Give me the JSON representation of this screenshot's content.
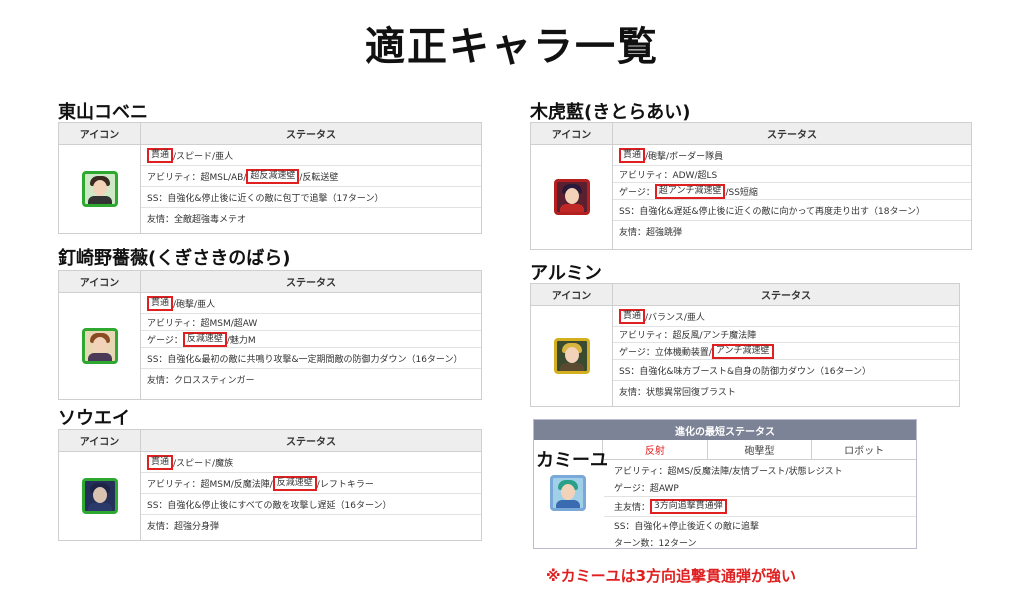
{
  "page_title": "適正キャラ一覧",
  "header": {
    "icon": "アイコン",
    "status": "ステータス"
  },
  "cards": [
    {
      "name": "東山コベニ",
      "rows": [
        {
          "hl": "貫通",
          "text": "/スピード/亜人"
        },
        {
          "pre": "アビリティ：超MSL/AB/",
          "hl": "超反減速壁",
          "text": "/反転送壁"
        },
        {
          "text": "SS：自強化&停止後に近くの敵に包丁で追撃（17ターン）"
        },
        {
          "text": "友情：全敵超強毒メテオ"
        }
      ]
    },
    {
      "name": "釘崎野薔薇(くぎさきのばら)",
      "rows": [
        {
          "hl": "貫通",
          "text": "/砲撃/亜人"
        },
        {
          "text": "アビリティ：超MSM/超AW"
        },
        {
          "pre": "ゲージ：",
          "hl": "反減速壁",
          "text": "/魅力M"
        },
        {
          "text": "SS：自強化&最初の敵に共鳴り攻撃&一定期間敵の防御力ダウン（16ターン）"
        },
        {
          "text": "友情：クロススティンガー"
        }
      ]
    },
    {
      "name": "ソウエイ",
      "rows": [
        {
          "hl": "貫通",
          "text": "/スピード/魔族"
        },
        {
          "pre": "アビリティ：超MSM/反魔法陣/",
          "hl": "反減速壁",
          "text": "/レフトキラー"
        },
        {
          "text": "SS：自強化&停止後にすべての敵を攻撃し遅延（16ターン）"
        },
        {
          "text": "友情：超強分身弾"
        }
      ]
    },
    {
      "name": "木虎藍(きとらあい)",
      "rows": [
        {
          "hl": "貫通",
          "text": "/砲撃/ボーダー隊員"
        },
        {
          "text": "アビリティ：ADW/超LS"
        },
        {
          "pre": "ゲージ：",
          "hl": "超アンチ減速壁",
          "text": "/SS短縮"
        },
        {
          "text": "SS：自強化&遅延&停止後に近くの敵に向かって再度走り出す（18ターン）"
        },
        {
          "text": "友情：超強跳弾"
        }
      ]
    },
    {
      "name": "アルミン",
      "rows": [
        {
          "hl": "貫通",
          "text": "/バランス/亜人"
        },
        {
          "text": "アビリティ：超反風/アンチ魔法陣"
        },
        {
          "pre": "ゲージ：立体機動装置/",
          "hl": "アンチ減速壁",
          "text": ""
        },
        {
          "text": "SS：自強化&味方ブースト&自身の防御力ダウン（16ターン）"
        },
        {
          "text": "友情：状態異常回復ブラスト"
        }
      ]
    }
  ],
  "evo": {
    "bar": "進化の最短ステータス",
    "name": "カミーユ",
    "tabs": [
      "反射",
      "砲撃型",
      "ロボット"
    ],
    "rows": [
      {
        "text": "アビリティ：超MS/反魔法陣/友情ブースト/状態レジスト"
      },
      {
        "text": "ゲージ：超AWP"
      },
      {
        "pre": "主友情：",
        "hl": "3方向追撃貫通弾",
        "text": ""
      },
      {
        "text": "SS：自強化+停止後近くの敵に追撃"
      },
      {
        "text": "ターン数：12ターン"
      }
    ]
  },
  "note": "※カミーユは3方向追撃貫通弾が強い"
}
